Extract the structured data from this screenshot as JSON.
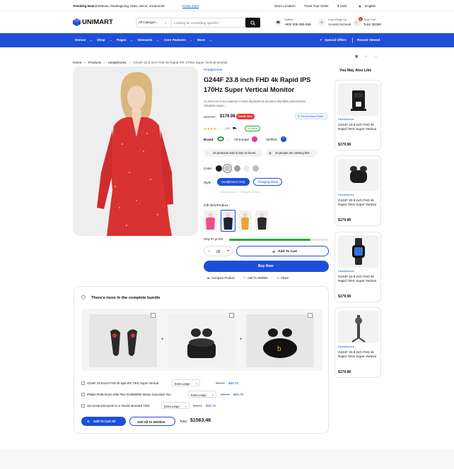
{
  "topbar": {
    "trending_label": "Trending Now :",
    "trending_text": "christmas, thanksgiving, trees, decor, ornaments",
    "know_more": "Know more",
    "store_location": "Store Location",
    "track_order": "Track Your Order",
    "currency": "$ USD",
    "language": "English"
  },
  "header": {
    "logo_text": "UNIMART",
    "category_select": "All Categori...",
    "search_placeholder": "Looking for something specific?",
    "hotline_label": "Hotline",
    "hotline_number": "+800 205-355-569",
    "account_line1": "Log in/Sign Up",
    "account_line2": "Access Account",
    "cart_line1": "Total Cart",
    "cart_line2": "Total: $2390",
    "cart_count": "2"
  },
  "nav": {
    "items": [
      "Demos",
      "Shop",
      "Pages",
      "Elements",
      "Core Features",
      "More"
    ],
    "special_offers": "Special Offers",
    "recent_viewed": "Recent Viewed"
  },
  "breadcrumb": [
    "Home",
    "Products",
    "Headphones",
    "G244F 23.8 inch FHD 4k Rapid IPS 170Hz Super Vertical Monitor"
  ],
  "product": {
    "category": "Headphones",
    "title_line1": "G244F 23.8 inch FHD 4k Rapid IPS",
    "title_line2": "170Hz Super Vertical Monitor",
    "desc_line1": "At vero eos et accusamus et iusto dignissimos ducimus blanditiis praesentium",
    "desc_line2": "voluptatu atque...",
    "old_price": "$196.00",
    "price": "$179.98",
    "sale_badge": "SAVE 20%",
    "find_store": "Find A Near Store",
    "stars": "★★★★☆",
    "rating_count": "(46)",
    "stock_badge": "In Stock",
    "brand_label": "Brand:",
    "shipping_label": "All Europe",
    "verified_label": "Verified",
    "sold_info": "34 products sold in last 10 hours.",
    "viewing_info": "20 people are viewing this",
    "color_label": "Color:",
    "colors": [
      "#1b1b1b",
      "#c9c3c6",
      "#9f9f9f",
      "#ececec",
      "#bdbdbd"
    ],
    "style_label": "Style :",
    "style_options": [
      "Headphones Only",
      "Charging Stand"
    ],
    "style_note": "Headphones + Charging Stand",
    "gift_label": "Gift Item/Product :",
    "stock_left": "Only 97 pc left",
    "stock_fill_pct": 82,
    "quantity": "05",
    "add_to_cart": "Add To Cart",
    "buy_now": "Buy Now",
    "compare": "Compare Product",
    "wishlist": "Add To Wishlist",
    "share": "Share"
  },
  "related": {
    "title": "You May Also Like",
    "items": [
      {
        "category": "Headphones",
        "name": "G244F 23.8 inch FHD 4k Rapid 70Hz Super Vertical",
        "price": "$179.98"
      },
      {
        "category": "Headphones",
        "name": "G244F 23.8 inch FHD 4k Rapid 70Hz Super Vertical",
        "price": "$179.98"
      },
      {
        "category": "Headphones",
        "name": "G244F 23.8 inch FHD 4k Rapid 70Hz Super Vertical",
        "price": "$179.98"
      },
      {
        "category": "Headphones",
        "name": "G244F 23.8 inch FHD 4k Rapid 70Hz Super Vertical",
        "price": "$179.98"
      }
    ]
  },
  "bundle": {
    "title": "There's more in the complete bundle",
    "rows": [
      {
        "name": "G244F 23.8 inch FHD 4k spid IPS 70Hz Super Vertical",
        "option": "Extra Large",
        "old_price": "$86.34",
        "price": "$69.78"
      },
      {
        "name": "Philips PerfectCare Elite Plus GC9682/80 Steam Generator Iron",
        "option": "Extra Large",
        "old_price": "$86.34",
        "price": "$69.78"
      },
      {
        "name": "Get Great Discounts on a Xiaomi Branded TWS",
        "option": "Extra Large",
        "old_price": "$86.34",
        "price": "$69.78"
      }
    ],
    "add_all_cart": "Add To Cart All",
    "add_all_wishlist": "Add All To Wishlist",
    "total_label": "Total:",
    "total": "$1563.46"
  }
}
